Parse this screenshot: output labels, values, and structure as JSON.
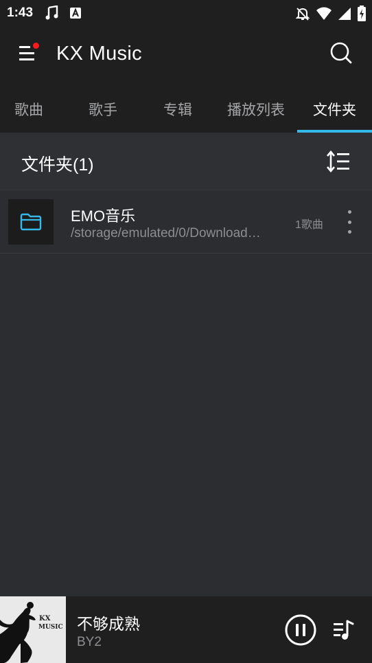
{
  "status_bar": {
    "time": "1:43",
    "icons": [
      "music-note-icon",
      "a-badge-icon",
      "bell-off-icon",
      "wifi-icon",
      "signal-icon",
      "battery-charging-icon"
    ]
  },
  "app_bar": {
    "title": "KX Music",
    "menu_icon": "menu-icon",
    "search_icon": "search-icon",
    "notification_dot_color": "#ff1a1a"
  },
  "tabs": [
    {
      "label": "歌曲",
      "active": false
    },
    {
      "label": "歌手",
      "active": false
    },
    {
      "label": "专辑",
      "active": false
    },
    {
      "label": "播放列表",
      "active": false
    },
    {
      "label": "文件夹",
      "active": true
    }
  ],
  "accent_color": "#35b9e8",
  "section": {
    "title": "文件夹(1)",
    "sort_icon": "sort-icon"
  },
  "folders": [
    {
      "name": "EMO音乐",
      "path": "/storage/emulated/0/Download…",
      "count": "1歌曲",
      "icon": "folder-icon"
    }
  ],
  "now_playing": {
    "title": "不够成熟",
    "artist": "BY2",
    "cover_text_line1": "KX",
    "cover_text_line2": "MUSIC",
    "state": "playing"
  }
}
